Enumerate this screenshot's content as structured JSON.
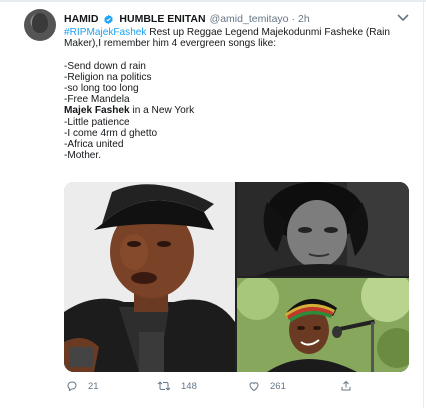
{
  "tweet": {
    "author_name": "HAMID",
    "verified_icon": "verified-badge-icon",
    "author_name2": "HUMBLE ENITAN",
    "handle": "@amid_temitayo",
    "separator": "·",
    "time": "2h",
    "more_icon": "more-options-icon",
    "hashtag": "#RIPMajekFashek",
    "line1_rest": " Rest up Reggae Legend Majekodunmi Fasheke (Rain",
    "line2": "Maker),I remember him 4 evergreen songs like:",
    "songs": [
      "-Send down d rain",
      "-Religion na politics",
      "-so long too long",
      "-Free Mandela",
      "-Little patience",
      "-I come 4rm d ghetto",
      "-Africa united",
      "-Mother."
    ],
    "song_bold_part": "Majek Fashek",
    "song_bold_rest": " in a New York"
  },
  "media": {
    "photos": [
      {
        "description_icon": "photo-icon"
      },
      {
        "description_icon": "photo-icon"
      },
      {
        "description_icon": "photo-icon"
      }
    ]
  },
  "actions": {
    "reply_count": "21",
    "retweet_count": "148",
    "like_count": "261",
    "reply_icon": "reply-icon",
    "retweet_icon": "retweet-icon",
    "like_icon": "heart-icon",
    "share_icon": "share-icon"
  },
  "colors": {
    "link": "#1da1f2",
    "muted": "#657786",
    "text": "#14171a",
    "verified": "#1da1f2"
  }
}
